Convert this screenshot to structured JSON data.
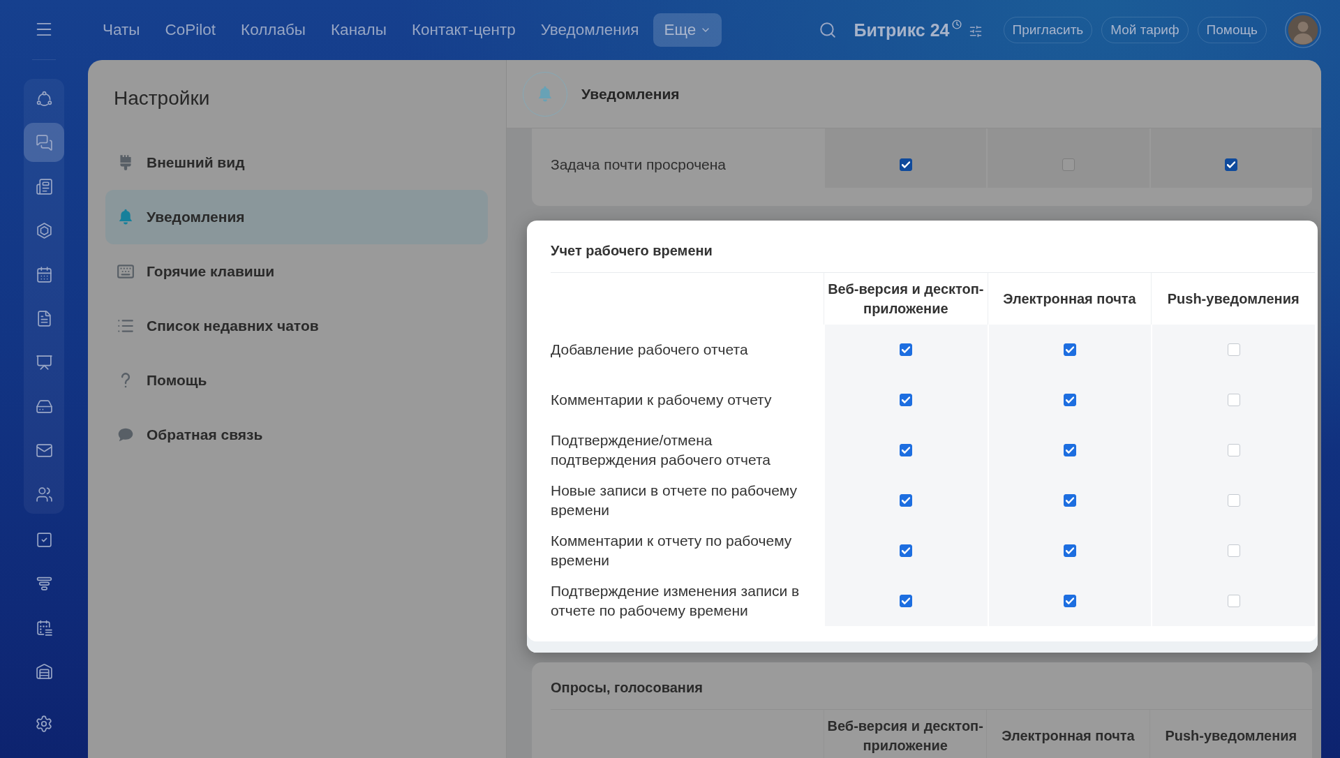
{
  "top_bar": {
    "nav": [
      {
        "label": "Чаты",
        "kind": "link",
        "selected": false
      },
      {
        "label": "CoPilot",
        "kind": "link",
        "selected": false
      },
      {
        "label": "Коллабы",
        "kind": "link",
        "selected": false
      },
      {
        "label": "Каналы",
        "kind": "link",
        "selected": false
      },
      {
        "label": "Контакт-центр",
        "kind": "link",
        "selected": false
      },
      {
        "label": "Уведомления",
        "kind": "link",
        "selected": false
      },
      {
        "label": "Еще",
        "kind": "dropdown",
        "selected": true
      }
    ],
    "logo": "Битрикс 24",
    "buttons": [
      "Пригласить",
      "Мой тариф",
      "Помощь"
    ]
  },
  "left_rail": {
    "pinned": [
      {
        "selected": false
      },
      {
        "selected": true
      },
      {
        "selected": false
      },
      {
        "selected": false
      },
      {
        "selected": false
      },
      {
        "selected": false
      },
      {
        "selected": false
      },
      {
        "selected": false
      },
      {
        "selected": false
      },
      {
        "selected": false
      }
    ],
    "items": [
      {
        "selected": false
      },
      {
        "selected": false
      },
      {
        "selected": false
      },
      {
        "selected": false
      }
    ],
    "settings": {
      "selected": false
    }
  },
  "settings_menu": {
    "title": "Настройки",
    "items": [
      {
        "label": "Внешний вид",
        "selected": false
      },
      {
        "label": "Уведомления",
        "selected": true
      },
      {
        "label": "Горячие клавиши",
        "selected": false
      },
      {
        "label": "Список недавних чатов",
        "selected": false
      },
      {
        "label": "Помощь",
        "selected": false
      },
      {
        "label": "Обратная связь",
        "selected": false
      }
    ]
  },
  "content": {
    "title": "Уведомления",
    "sections": [
      {
        "highlighted": false,
        "rows": [
          {
            "label": "Задача почти просрочена",
            "cells": [
              {
                "checked": true
              },
              {
                "checked": false
              },
              {
                "checked": true
              }
            ]
          }
        ]
      },
      {
        "title": "Учет рабочего времени",
        "highlighted": true,
        "columns": [
          "Веб-версия и десктоп-приложение",
          "Электронная почта",
          "Push-уведомления"
        ],
        "rows": [
          {
            "label": "Добавление рабочего отчета",
            "cells": [
              {
                "checked": true
              },
              {
                "checked": true
              },
              {
                "checked": false
              }
            ]
          },
          {
            "label": "Комментарии к рабочему отчету",
            "cells": [
              {
                "checked": true
              },
              {
                "checked": true
              },
              {
                "checked": false
              }
            ]
          },
          {
            "label": "Подтверждение/отмена подтверждения рабочего отчета",
            "cells": [
              {
                "checked": true
              },
              {
                "checked": true
              },
              {
                "checked": false
              }
            ]
          },
          {
            "label": "Новые записи в отчете по рабочему времени",
            "cells": [
              {
                "checked": true
              },
              {
                "checked": true
              },
              {
                "checked": false
              }
            ]
          },
          {
            "label": "Комментарии к отчету по рабочему времени",
            "cells": [
              {
                "checked": true
              },
              {
                "checked": true
              },
              {
                "checked": false
              }
            ]
          },
          {
            "label": "Подтверждение изменения записи в отчете по рабочему времени",
            "cells": [
              {
                "checked": true
              },
              {
                "checked": true
              },
              {
                "checked": false
              }
            ]
          }
        ]
      },
      {
        "title": "Опросы, голосования",
        "highlighted": false,
        "columns": [
          "Веб-версия и десктоп-приложение",
          "Электронная почта",
          "Push-уведомления"
        ]
      }
    ]
  }
}
